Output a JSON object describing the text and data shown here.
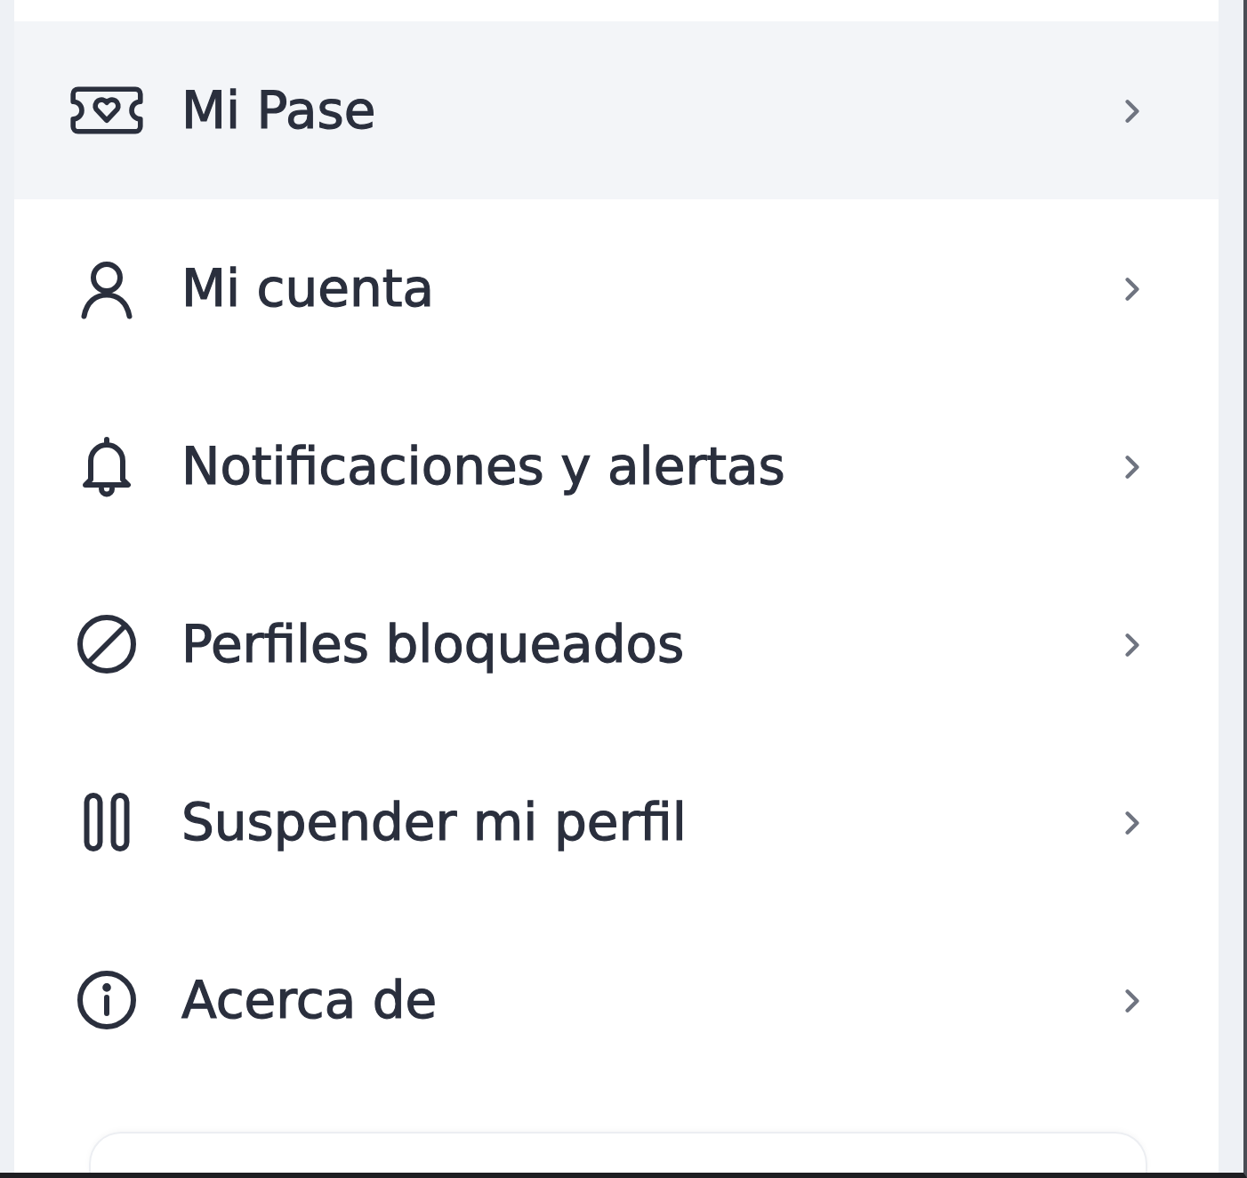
{
  "menu": {
    "items": [
      {
        "label": "Mi Pase",
        "selected": true
      },
      {
        "label": "Mi cuenta",
        "selected": false
      },
      {
        "label": "Notificaciones y alertas",
        "selected": false
      },
      {
        "label": "Perfiles bloqueados",
        "selected": false
      },
      {
        "label": "Suspender mi perfil",
        "selected": false
      },
      {
        "label": "Acerca de",
        "selected": false
      }
    ]
  }
}
